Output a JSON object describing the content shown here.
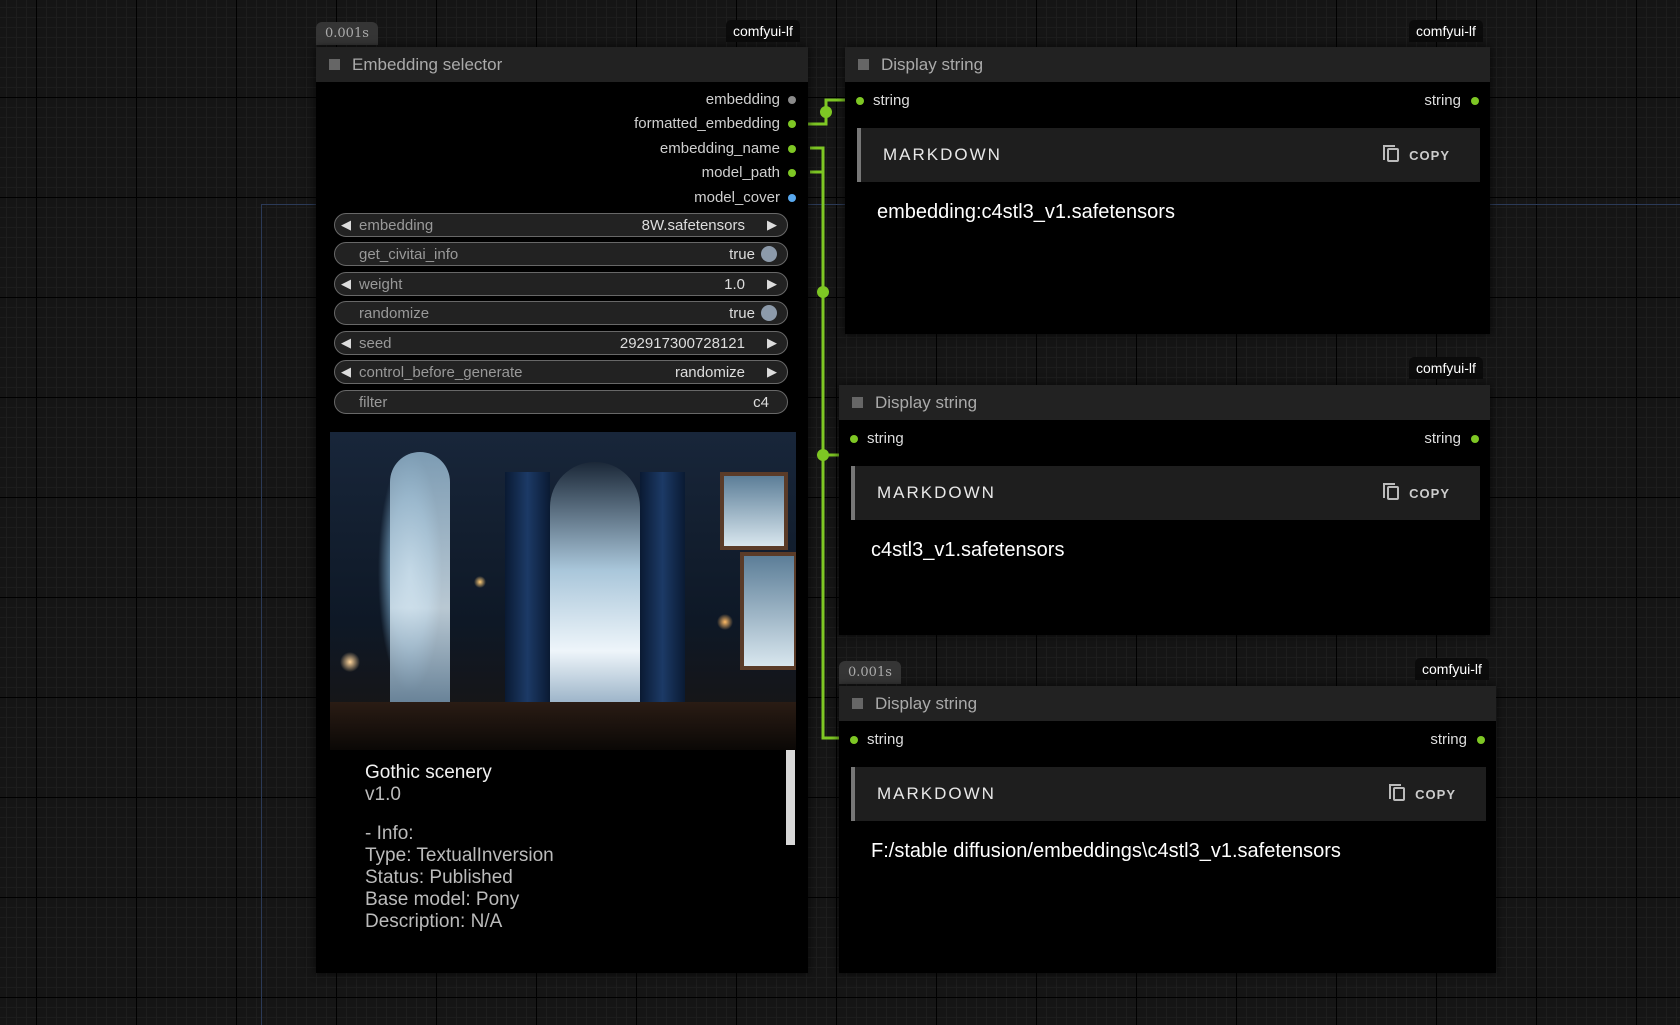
{
  "selector_node": {
    "timer": "0.001s",
    "badge": "comfyui-lf",
    "title": "Embedding selector",
    "outputs": [
      {
        "label": "embedding",
        "color": "grey"
      },
      {
        "label": "formatted_embedding",
        "color": "green"
      },
      {
        "label": "embedding_name",
        "color": "green"
      },
      {
        "label": "model_path",
        "color": "green"
      },
      {
        "label": "model_cover",
        "color": "blue"
      }
    ],
    "widgets": [
      {
        "label": "embedding",
        "value": "8W.safetensors",
        "kind": "combo"
      },
      {
        "label": "get_civitai_info",
        "value": "true",
        "kind": "toggle"
      },
      {
        "label": "weight",
        "value": "1.0",
        "kind": "number"
      },
      {
        "label": "randomize",
        "value": "true",
        "kind": "toggle"
      },
      {
        "label": "seed",
        "value": "292917300728121",
        "kind": "number"
      },
      {
        "label": "control_before_generate",
        "value": "randomize",
        "kind": "combo"
      },
      {
        "label": "filter",
        "value": "c4",
        "kind": "text"
      }
    ],
    "info": {
      "name": "Gothic scenery",
      "version": "v1.0",
      "lines": [
        "- Info:",
        "Type: TextualInversion",
        "Status: Published",
        "Base model: Pony",
        "Description: N/A"
      ]
    }
  },
  "display_nodes": [
    {
      "badge": "comfyui-lf",
      "title": "Display string",
      "input": "string",
      "output": "string",
      "md_label": "MARKDOWN",
      "copy_label": "COPY",
      "text": "embedding:c4stl3_v1.safetensors"
    },
    {
      "badge": "comfyui-lf",
      "title": "Display string",
      "input": "string",
      "output": "string",
      "md_label": "MARKDOWN",
      "copy_label": "COPY",
      "text": "c4stl3_v1.safetensors"
    },
    {
      "timer": "0.001s",
      "badge": "comfyui-lf",
      "title": "Display string",
      "input": "string",
      "output": "string",
      "md_label": "MARKDOWN",
      "copy_label": "COPY",
      "text": "F:/stable diffusion/embeddings\\c4stl3_v1.safetensors"
    }
  ],
  "colors": {
    "link": "#7ec724",
    "slot_blue": "#59a9ef",
    "node_bg": "#000000",
    "header_bg": "#222222"
  }
}
